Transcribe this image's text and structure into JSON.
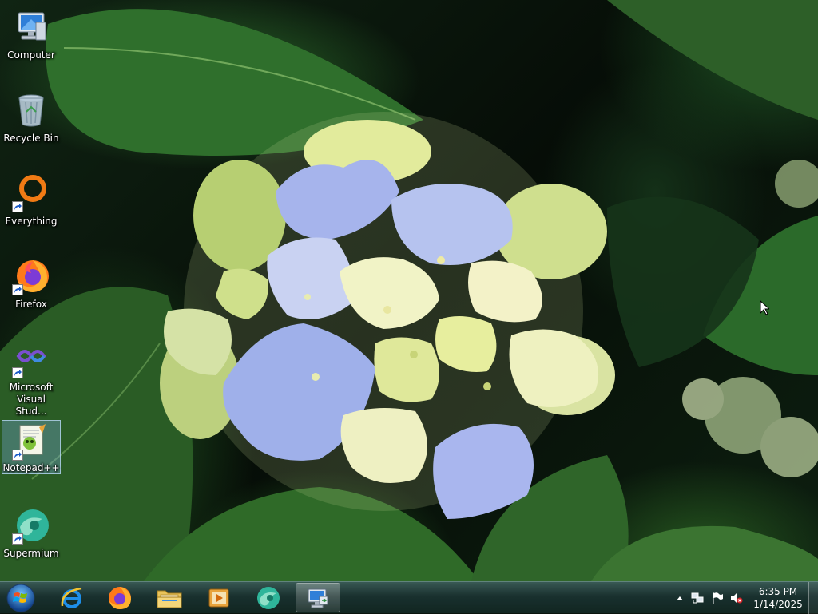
{
  "desktop": {
    "icons": [
      {
        "label": "Computer",
        "icon": "computer-icon"
      },
      {
        "label": "Recycle Bin",
        "icon": "recycle-bin-icon"
      },
      {
        "label": "Everything",
        "icon": "everything-icon"
      },
      {
        "label": "Firefox",
        "icon": "firefox-icon"
      },
      {
        "label": "Microsoft Visual Stud...",
        "icon": "visual-studio-icon"
      },
      {
        "label": "Notepad++",
        "icon": "notepad-plus-plus-icon",
        "selected": true
      },
      {
        "label": "Supermium",
        "icon": "supermium-icon"
      }
    ]
  },
  "taskbar": {
    "start_icon": "windows-orb-icon",
    "pinned": [
      {
        "name": "Internet Explorer",
        "icon": "internet-explorer-icon"
      },
      {
        "name": "Firefox",
        "icon": "firefox-icon"
      },
      {
        "name": "File Explorer",
        "icon": "file-explorer-icon"
      },
      {
        "name": "Media Player",
        "icon": "media-player-icon"
      },
      {
        "name": "Supermium",
        "icon": "supermium-icon"
      },
      {
        "name": "Remote Desktop",
        "icon": "remote-desktop-icon",
        "active": true
      }
    ],
    "tray": {
      "icons": [
        "show-hidden-icons-chevron",
        "network-icon",
        "action-center-flag-icon",
        "volume-muted-icon"
      ],
      "time": "6:35 PM",
      "date": "1/14/2025"
    }
  },
  "colors": {
    "taskbar": "#1e3a36",
    "selection": "#78aadc",
    "leaf": "#2c6a2b",
    "petal_blue": "#9fb0ea",
    "petal_cream": "#e8eeb4"
  }
}
